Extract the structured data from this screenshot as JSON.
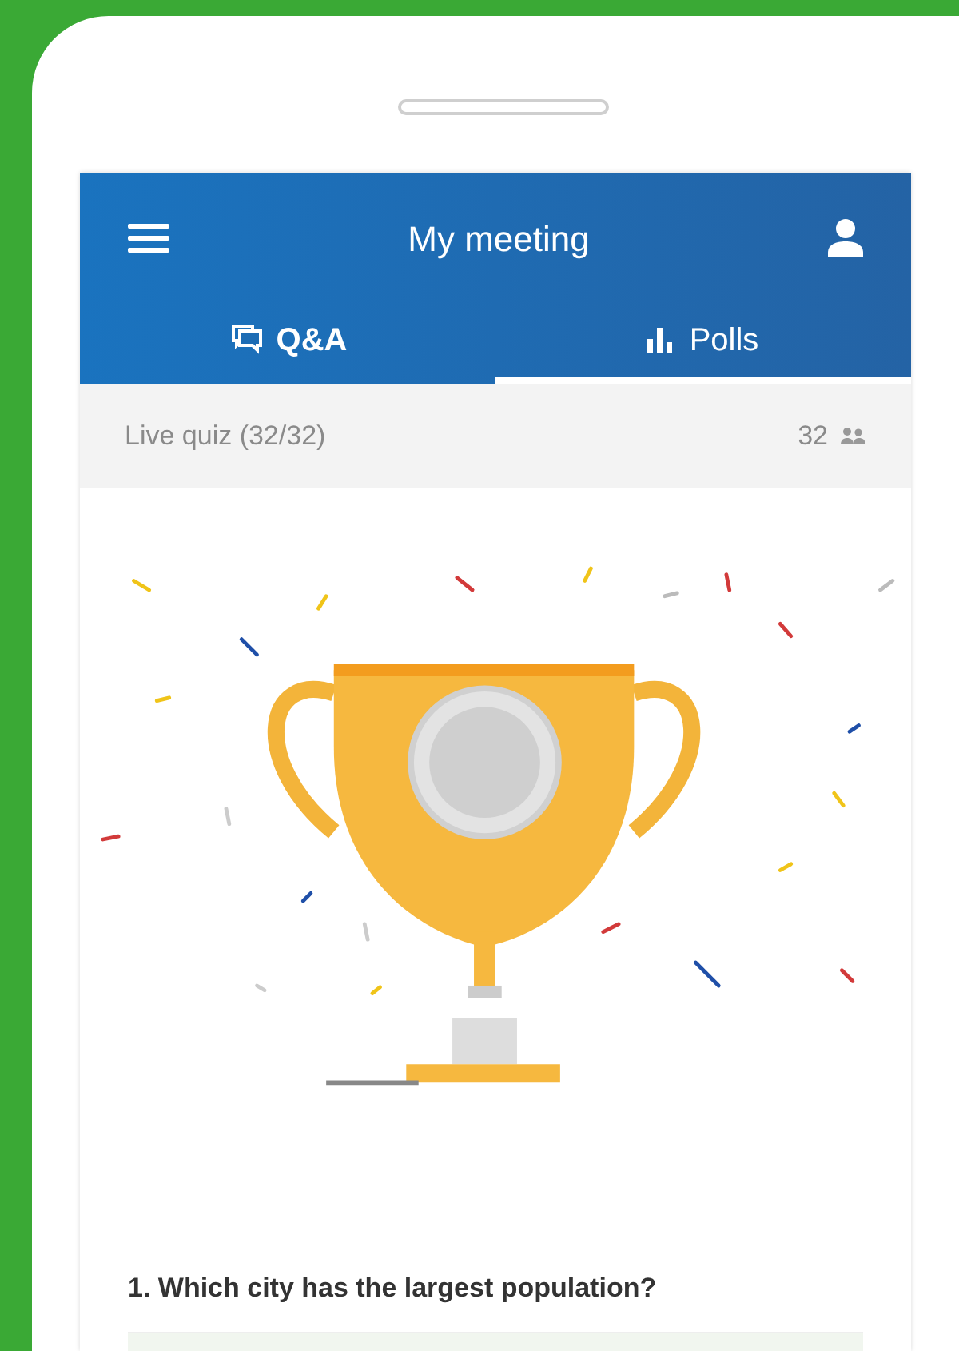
{
  "header": {
    "title": "My meeting"
  },
  "tabs": [
    {
      "label": "Q&A",
      "kind": "chat",
      "selected": false
    },
    {
      "label": "Polls",
      "kind": "bars",
      "selected": true
    }
  ],
  "info_bar": {
    "label": "Live quiz (32/32)",
    "count": "32"
  },
  "question": {
    "text": "1. Which city has the largest population?"
  }
}
